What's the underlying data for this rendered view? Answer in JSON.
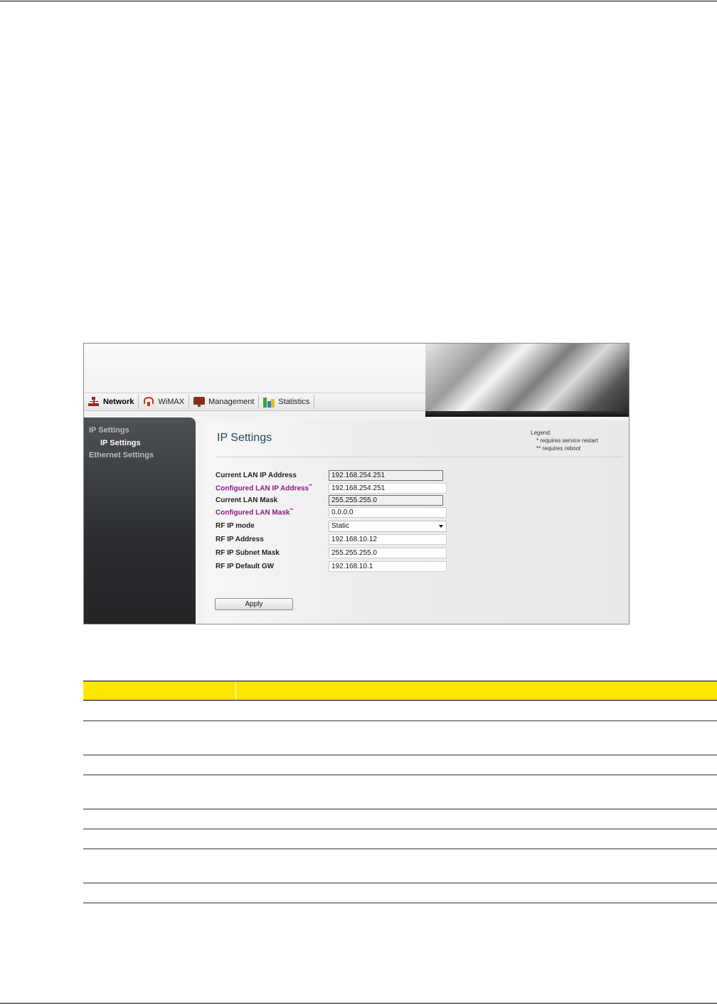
{
  "nav": {
    "tabs": [
      {
        "label": "Network",
        "icon": "network-icon",
        "active": true
      },
      {
        "label": "WiMAX",
        "icon": "wimax-icon",
        "active": false
      },
      {
        "label": "Management",
        "icon": "management-icon",
        "active": false
      },
      {
        "label": "Statistics",
        "icon": "statistics-icon",
        "active": false
      }
    ]
  },
  "sidebar": {
    "items": [
      {
        "label": "IP Settings"
      },
      {
        "label": "IP Settings"
      },
      {
        "label": "Ethernet Settings"
      }
    ]
  },
  "main": {
    "title": "IP Settings",
    "legend": {
      "heading": "Legend:",
      "items": [
        {
          "mark": "*",
          "text": "requires service restart"
        },
        {
          "mark": "**",
          "text": "requires reboot"
        }
      ]
    },
    "fields": [
      {
        "label": "Current LAN IP Address",
        "value": "192.168.254.251",
        "readonly": true
      },
      {
        "label": "Configured LAN IP Address",
        "mark": "**",
        "value": "192.168.254.251"
      },
      {
        "label": "Current LAN Mask",
        "value": "255.255.255.0",
        "readonly": true
      },
      {
        "label": "Configured LAN Mask",
        "mark": "**",
        "value": "0.0.0.0"
      },
      {
        "label": "RF IP mode",
        "value": "Static",
        "type": "select"
      },
      {
        "label": "RF IP Address",
        "value": "192.168.10.12"
      },
      {
        "label": "RF IP Subnet Mask",
        "value": "255.255.255.0"
      },
      {
        "label": "RF IP Default GW",
        "value": "192.168.10.1"
      }
    ],
    "apply_label": "Apply"
  },
  "colors": {
    "table_header": "#ffe600",
    "configured_label": "#8b1a8b",
    "title": "#2a4563"
  }
}
